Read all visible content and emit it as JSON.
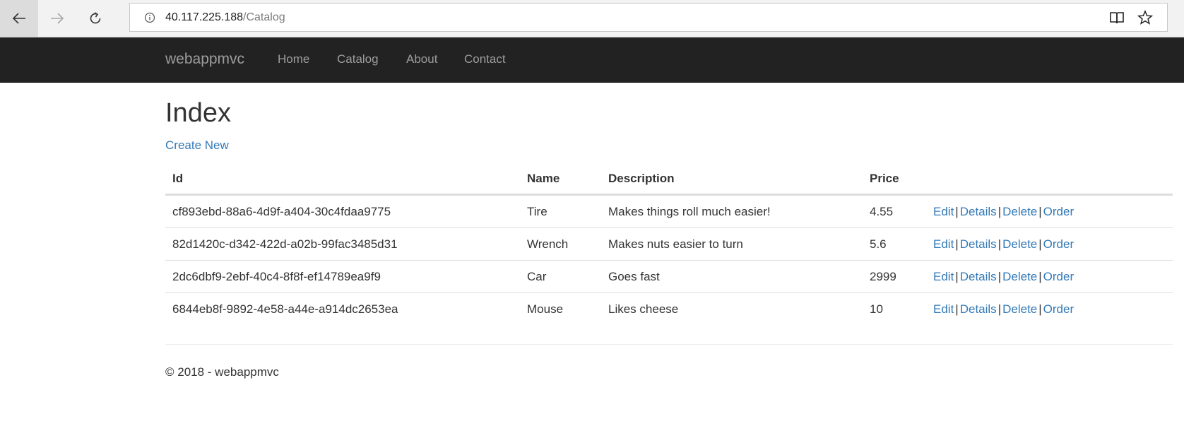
{
  "browser": {
    "url_host": "40.117.225.188",
    "url_path": "/Catalog"
  },
  "navbar": {
    "brand": "webappmvc",
    "links": [
      "Home",
      "Catalog",
      "About",
      "Contact"
    ]
  },
  "page": {
    "title": "Index",
    "create_label": "Create New"
  },
  "table": {
    "headers": [
      "Id",
      "Name",
      "Description",
      "Price"
    ],
    "rows": [
      {
        "id": "cf893ebd-88a6-4d9f-a404-30c4fdaa9775",
        "name": "Tire",
        "description": "Makes things roll much easier!",
        "price": "4.55"
      },
      {
        "id": "82d1420c-d342-422d-a02b-99fac3485d31",
        "name": "Wrench",
        "description": "Makes nuts easier to turn",
        "price": "5.6"
      },
      {
        "id": "2dc6dbf9-2ebf-40c4-8f8f-ef14789ea9f9",
        "name": "Car",
        "description": "Goes fast",
        "price": "2999"
      },
      {
        "id": "6844eb8f-9892-4e58-a44e-a914dc2653ea",
        "name": "Mouse",
        "description": "Likes cheese",
        "price": "10"
      }
    ],
    "actions": [
      "Edit",
      "Details",
      "Delete",
      "Order"
    ],
    "separator": "|"
  },
  "footer": {
    "text": "© 2018 - webappmvc"
  },
  "colors": {
    "navbar_bg": "#222222",
    "nav_text": "#9d9d9d",
    "link": "#337ab7"
  },
  "icons": [
    "back-arrow-icon",
    "forward-arrow-icon",
    "refresh-icon",
    "info-icon",
    "reading-view-icon",
    "favorite-star-icon"
  ]
}
